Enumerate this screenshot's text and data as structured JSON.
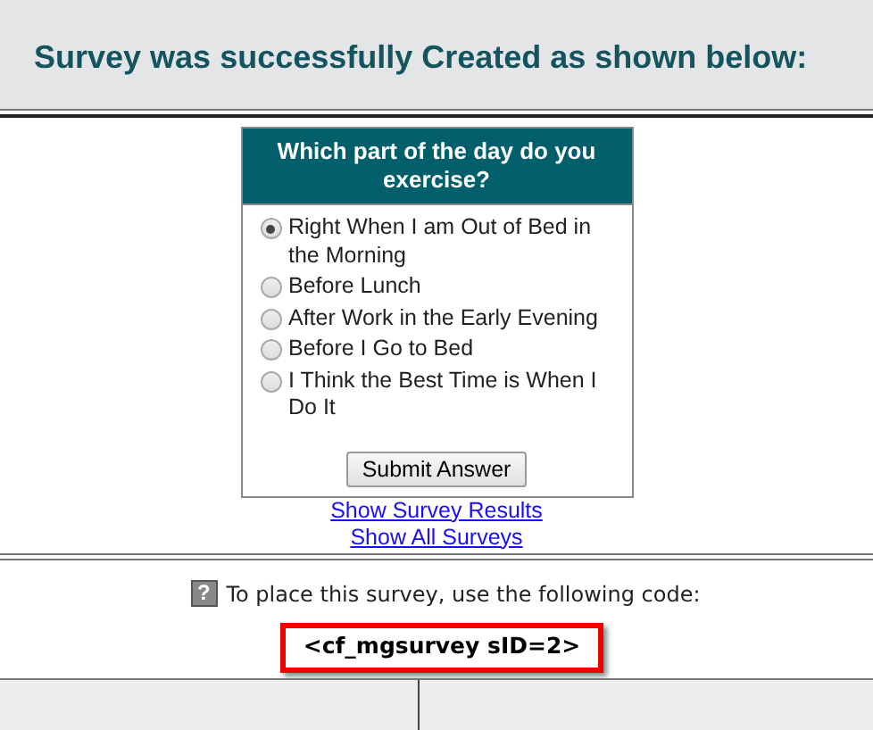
{
  "heading": "Survey was successfully Created as shown below:",
  "survey": {
    "question": "Which part of the day do you exercise?",
    "options": [
      {
        "label": "Right When I am Out of Bed in the Morning",
        "selected": true
      },
      {
        "label": "Before Lunch",
        "selected": false
      },
      {
        "label": "After Work in the Early Evening",
        "selected": false
      },
      {
        "label": "Before I Go to Bed",
        "selected": false
      },
      {
        "label": "I Think the Best Time is When I Do It",
        "selected": false
      }
    ],
    "submit": "Submit Answer"
  },
  "links": [
    "Show Survey Results",
    "Show All Surveys"
  ],
  "help_icon": "?",
  "instruction": "To place this survey, use the following code:",
  "code": "<cf_mgsurvey sID=2>"
}
